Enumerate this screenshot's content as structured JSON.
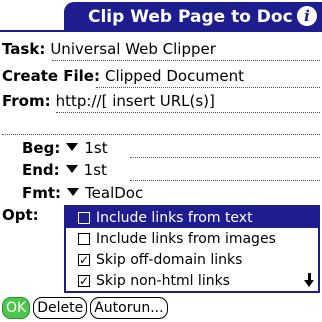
{
  "app": {
    "title": "Clip Web Page to Doc",
    "info_icon_glyph": "i"
  },
  "fields": {
    "task_label": "Task:",
    "task_value": "Universal Web Clipper",
    "create_file_label": "Create File:",
    "create_file_value": "Clipped Document",
    "from_label": "From:",
    "from_value": "http://[ insert URL(s)]"
  },
  "selectors": {
    "beg_label": "Beg:",
    "beg_value": "1st",
    "end_label": "End:",
    "end_value": "1st",
    "fmt_label": "Fmt:",
    "fmt_value": "TealDoc",
    "opt_label": "Opt:"
  },
  "options_popup": {
    "items": [
      {
        "label": "Include links from text",
        "checked": false,
        "selected": true
      },
      {
        "label": "Include links from images",
        "checked": false,
        "selected": false
      },
      {
        "label": "Skip off-domain links",
        "checked": true,
        "selected": false
      },
      {
        "label": "Skip non-html links",
        "checked": true,
        "selected": false
      }
    ],
    "scroll_icon": "scroll-down-arrow"
  },
  "buttons": {
    "ok": "OK",
    "delete": "Delete",
    "autorun": "Autorun..."
  },
  "colors": {
    "accent": "#1d1d8f",
    "ok_button": "#4cc64c"
  }
}
